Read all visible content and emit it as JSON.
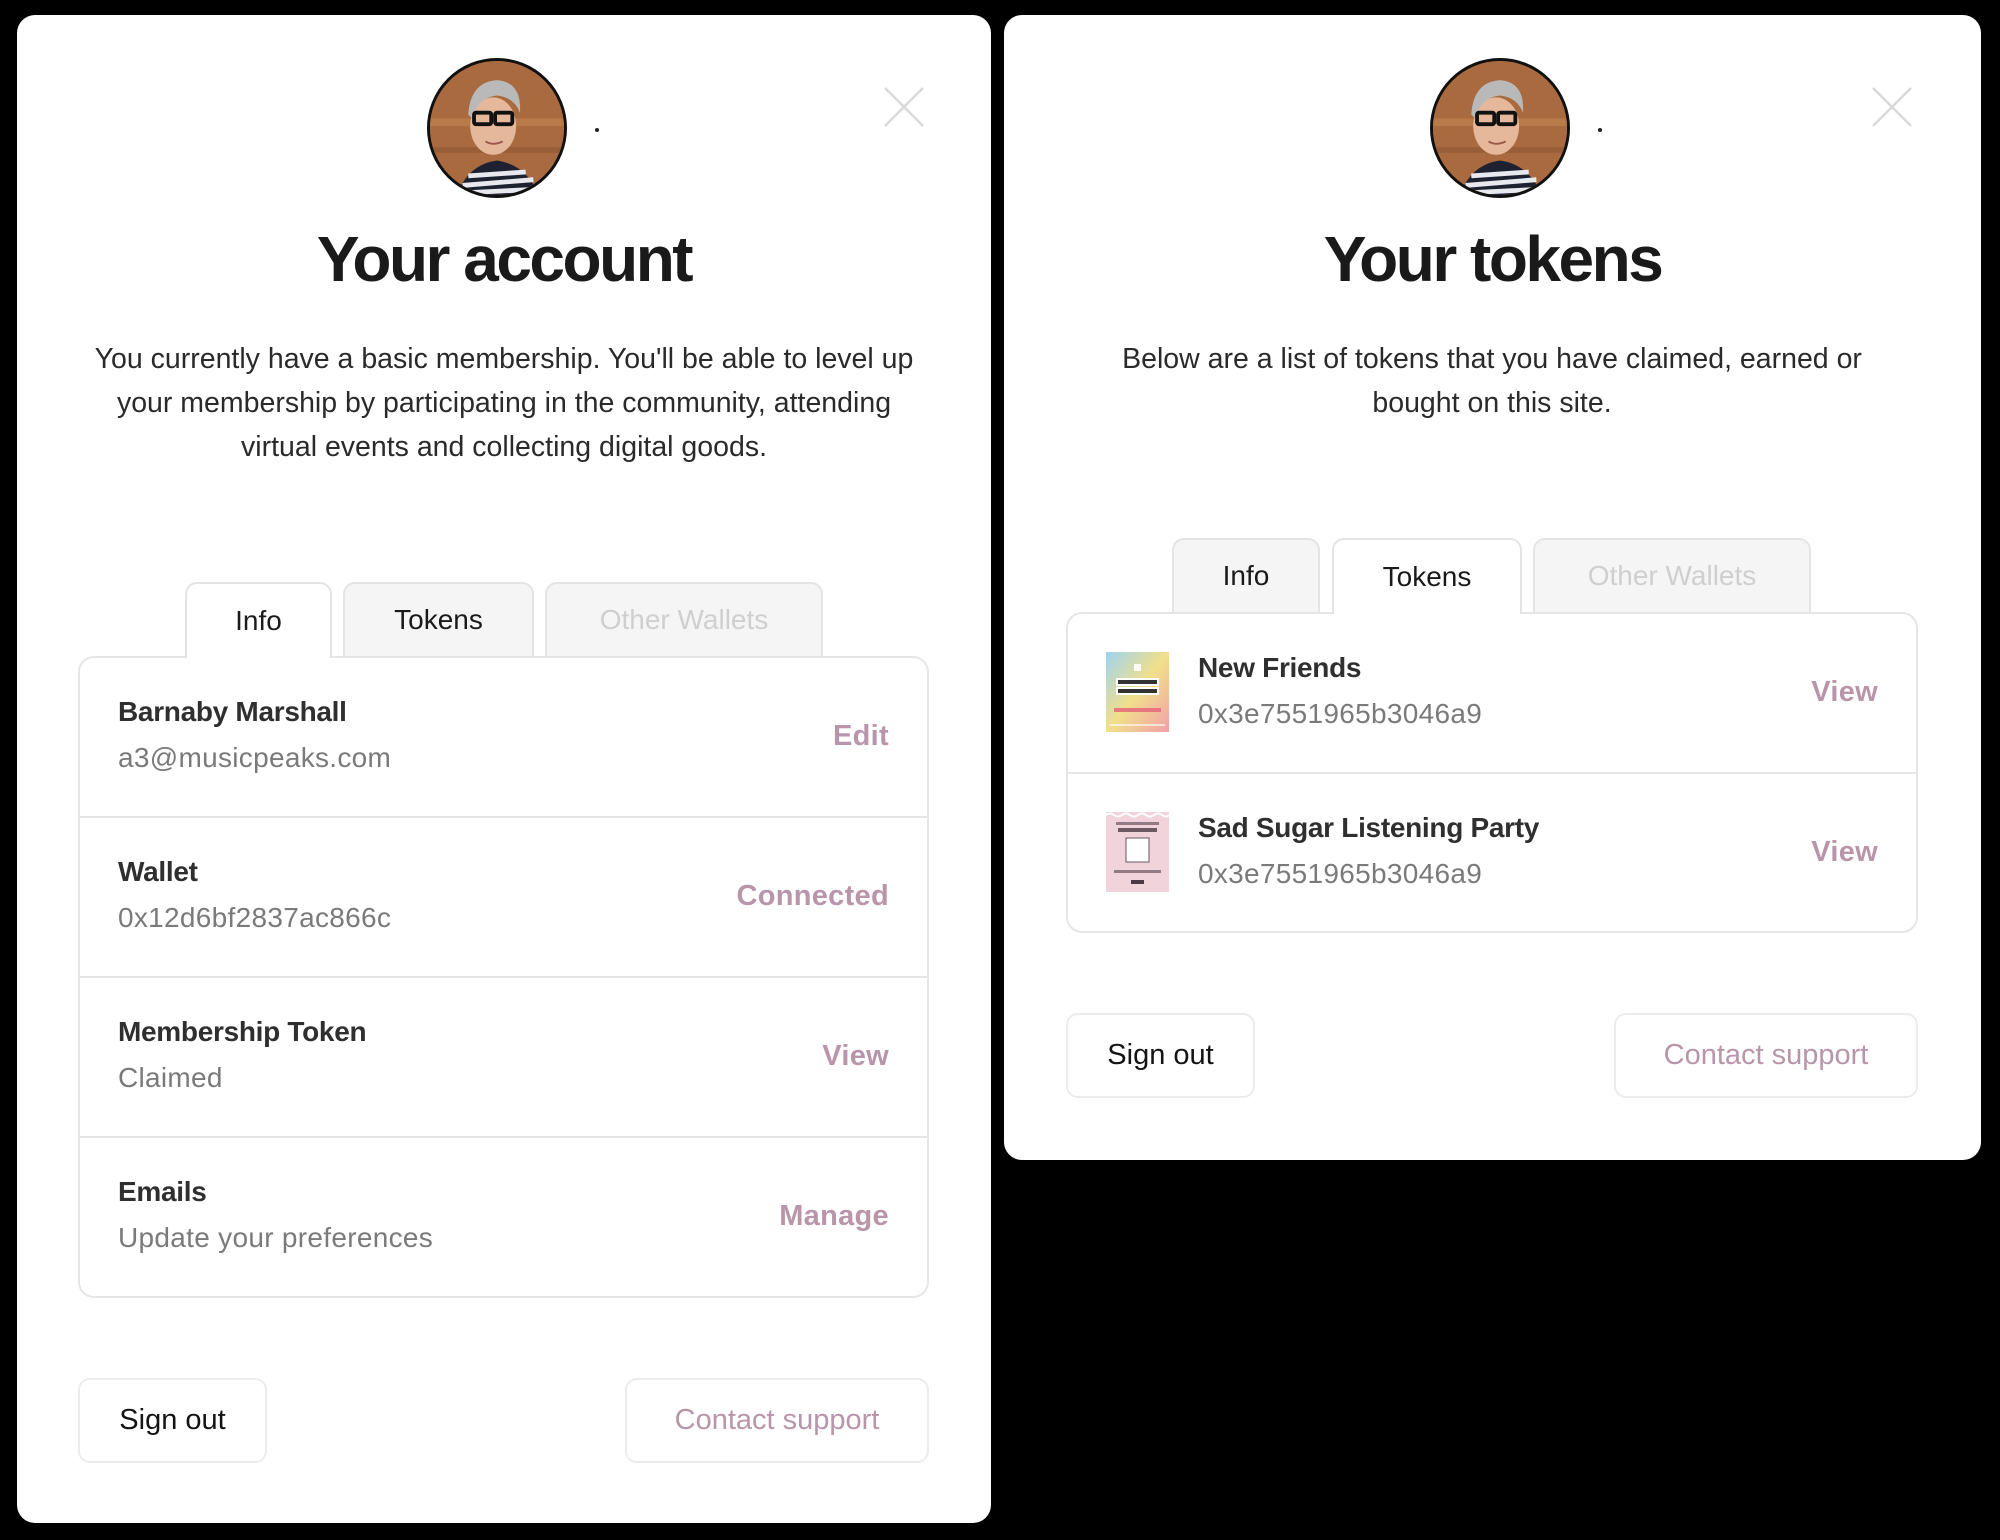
{
  "theme": {
    "accent": "#b995aa",
    "background": "#000000",
    "panel": "#ffffff",
    "muted_text": "#7a7a7a",
    "disabled_tab_text": "#cfcfcf"
  },
  "account_panel": {
    "avatar_alt": "Profile photo",
    "close_icon": "close-icon",
    "title": "Your account",
    "description": "You currently have a basic membership. You'll be able to level up your membership by participating in the community, attending virtual events and collecting digital goods.",
    "tabs": [
      {
        "label": "Info",
        "state": "active"
      },
      {
        "label": "Tokens",
        "state": "inactive"
      },
      {
        "label": "Other Wallets",
        "state": "disabled"
      }
    ],
    "rows": [
      {
        "title": "Barnaby Marshall",
        "subtitle": "a3@musicpeaks.com",
        "action": "Edit"
      },
      {
        "title": "Wallet",
        "subtitle": "0x12d6bf2837ac866c",
        "action": "Connected"
      },
      {
        "title": "Membership Token",
        "subtitle": "Claimed",
        "action": "View"
      },
      {
        "title": "Emails",
        "subtitle": "Update your preferences",
        "action": "Manage"
      }
    ],
    "buttons": {
      "sign_out": "Sign out",
      "contact_support": "Contact support"
    }
  },
  "tokens_panel": {
    "avatar_alt": "Profile photo",
    "close_icon": "close-icon",
    "title": "Your tokens",
    "description": "Below are a list of tokens that you have claimed, earned or bought on this site.",
    "tabs": [
      {
        "label": "Info",
        "state": "inactive"
      },
      {
        "label": "Tokens",
        "state": "active"
      },
      {
        "label": "Other Wallets",
        "state": "disabled"
      }
    ],
    "tokens": [
      {
        "name": "New Friends",
        "address": "0x3e7551965b3046a9",
        "action": "View",
        "thumbnail": "new-friends-membership-card"
      },
      {
        "name": "Sad Sugar Listening Party",
        "address": "0x3e7551965b3046a9",
        "action": "View",
        "thumbnail": "sad-sugar-ticket"
      }
    ],
    "buttons": {
      "sign_out": "Sign out",
      "contact_support": "Contact support"
    }
  }
}
